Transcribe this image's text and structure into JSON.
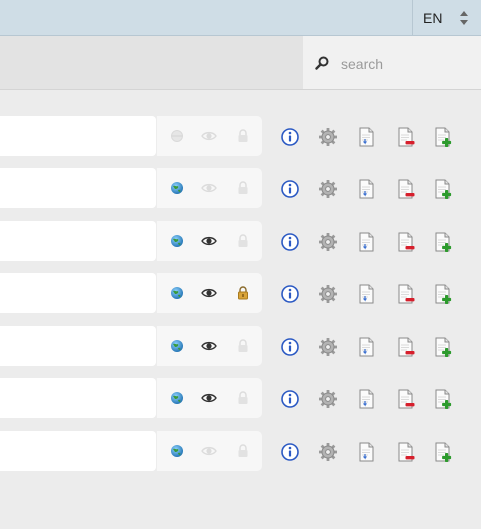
{
  "header": {
    "language": {
      "value": "EN",
      "icon": "up-down-arrows-icon"
    }
  },
  "search": {
    "placeholder": "search",
    "icon": "search-icon"
  },
  "rows": [
    {
      "published": false,
      "visible": false,
      "locked": false
    },
    {
      "published": true,
      "visible": false,
      "locked": false
    },
    {
      "published": true,
      "visible": true,
      "locked": false
    },
    {
      "published": true,
      "visible": true,
      "locked": true
    },
    {
      "published": true,
      "visible": true,
      "locked": false
    },
    {
      "published": true,
      "visible": true,
      "locked": false
    },
    {
      "published": true,
      "visible": false,
      "locked": false
    }
  ],
  "row_actions": [
    {
      "icon": "info-icon",
      "action": "info"
    },
    {
      "icon": "gear-icon",
      "action": "settings"
    },
    {
      "icon": "document-icon",
      "action": "open"
    },
    {
      "icon": "remove-page-icon",
      "action": "remove"
    },
    {
      "icon": "add-page-icon",
      "action": "add"
    }
  ],
  "colors": {
    "topbar": "#cfdde6",
    "subbar": "#e3e3e3",
    "background": "#ececec",
    "info_blue": "#2b59c3",
    "remove_red": "#d61f2c",
    "add_green": "#2c9a2c"
  }
}
